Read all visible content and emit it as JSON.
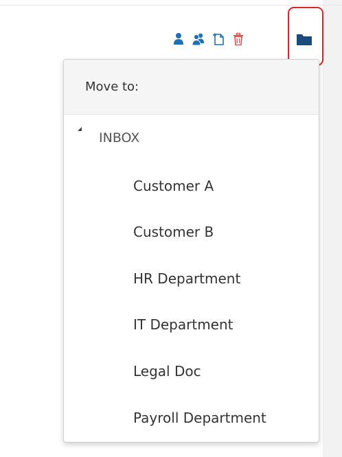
{
  "toolbar": {
    "icons": [
      "user-icon",
      "users-icon",
      "new-document-icon",
      "trash-icon",
      "folder-icon"
    ],
    "icon_color": "#1f6fb5",
    "delete_color": "#d9534f",
    "active_folder_color": "#1a4b7a",
    "highlight_color": "#e32029"
  },
  "dropdown": {
    "title": "Move to:",
    "root": {
      "label": "INBOX",
      "expanded": true,
      "children": [
        {
          "label": "Customer A"
        },
        {
          "label": "Customer B"
        },
        {
          "label": "HR Department"
        },
        {
          "label": "IT Department"
        },
        {
          "label": "Legal Doc"
        },
        {
          "label": "Payroll Department"
        }
      ]
    }
  }
}
